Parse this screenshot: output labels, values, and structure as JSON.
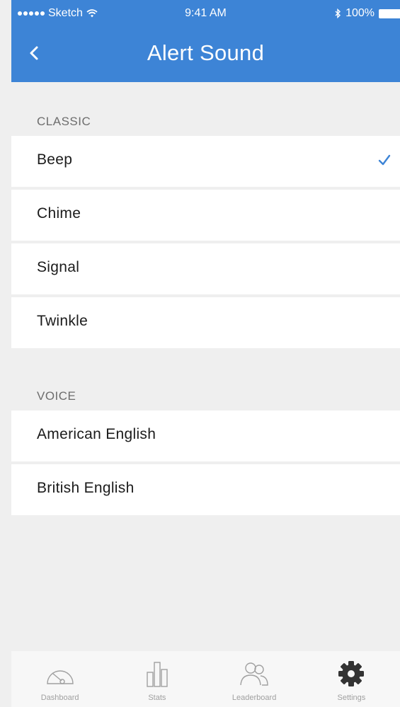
{
  "status_bar": {
    "carrier": "Sketch",
    "time": "9:41 AM",
    "battery": "100%"
  },
  "nav": {
    "title": "Alert Sound",
    "back_icon": "chevron-left-icon"
  },
  "sections": [
    {
      "header": "CLASSIC",
      "items": [
        {
          "label": "Beep",
          "selected": true
        },
        {
          "label": "Chime",
          "selected": false
        },
        {
          "label": "Signal",
          "selected": false
        },
        {
          "label": "Twinkle",
          "selected": false
        }
      ]
    },
    {
      "header": "VOICE",
      "items": [
        {
          "label": "American English",
          "selected": false
        },
        {
          "label": "British English",
          "selected": false
        }
      ]
    }
  ],
  "tab_bar": {
    "tabs": [
      {
        "label": "Dashboard",
        "icon": "gauge-icon",
        "active": false
      },
      {
        "label": "Stats",
        "icon": "bar-chart-icon",
        "active": false
      },
      {
        "label": "Leaderboard",
        "icon": "people-icon",
        "active": false
      },
      {
        "label": "Settings",
        "icon": "gear-icon",
        "active": true
      }
    ]
  },
  "colors": {
    "accent": "#3d84d6",
    "background": "#efefef",
    "row": "#ffffff",
    "tab_inactive": "#a0a0a0",
    "tab_active": "#333333"
  }
}
